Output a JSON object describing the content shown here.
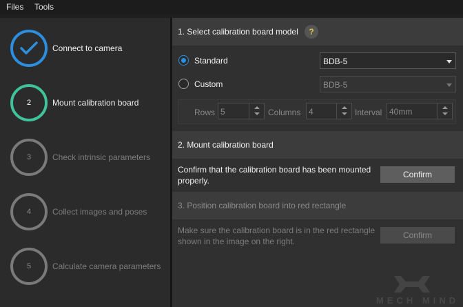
{
  "menu": [
    "Files",
    "Tools"
  ],
  "steps": [
    {
      "number": "",
      "label": "Connect to camera",
      "state": "done"
    },
    {
      "number": "2",
      "label": "Mount calibration board",
      "state": "active"
    },
    {
      "number": "3",
      "label": "Check intrinsic parameters",
      "state": "pending"
    },
    {
      "number": "4",
      "label": "Collect images and poses",
      "state": "pending"
    },
    {
      "number": "5",
      "label": "Calculate camera parameters",
      "state": "pending"
    }
  ],
  "section1": {
    "title": "1. Select calibration board model",
    "help": "?",
    "standard_label": "Standard",
    "standard_value": "BDB-5",
    "standard_selected": true,
    "custom_label": "Custom",
    "custom_value": "BDB-5",
    "rows_label": "Rows",
    "rows_value": "5",
    "columns_label": "Columns",
    "columns_value": "4",
    "interval_label": "Interval",
    "interval_value": "40mm"
  },
  "section2": {
    "title": "2. Mount calibration board",
    "text": "Confirm that the calibration board has been mounted properly.",
    "button": "Confirm"
  },
  "section3": {
    "title": "3. Position calibration board into red rectangle",
    "text": "Make sure the calibration board is in the red rectangle shown in the image on the right.",
    "button": "Confirm"
  },
  "watermark": "MECH MIND",
  "colors": {
    "done": "#2d8ee0",
    "active": "#3fc39a",
    "pending": "#7a7a7a"
  }
}
